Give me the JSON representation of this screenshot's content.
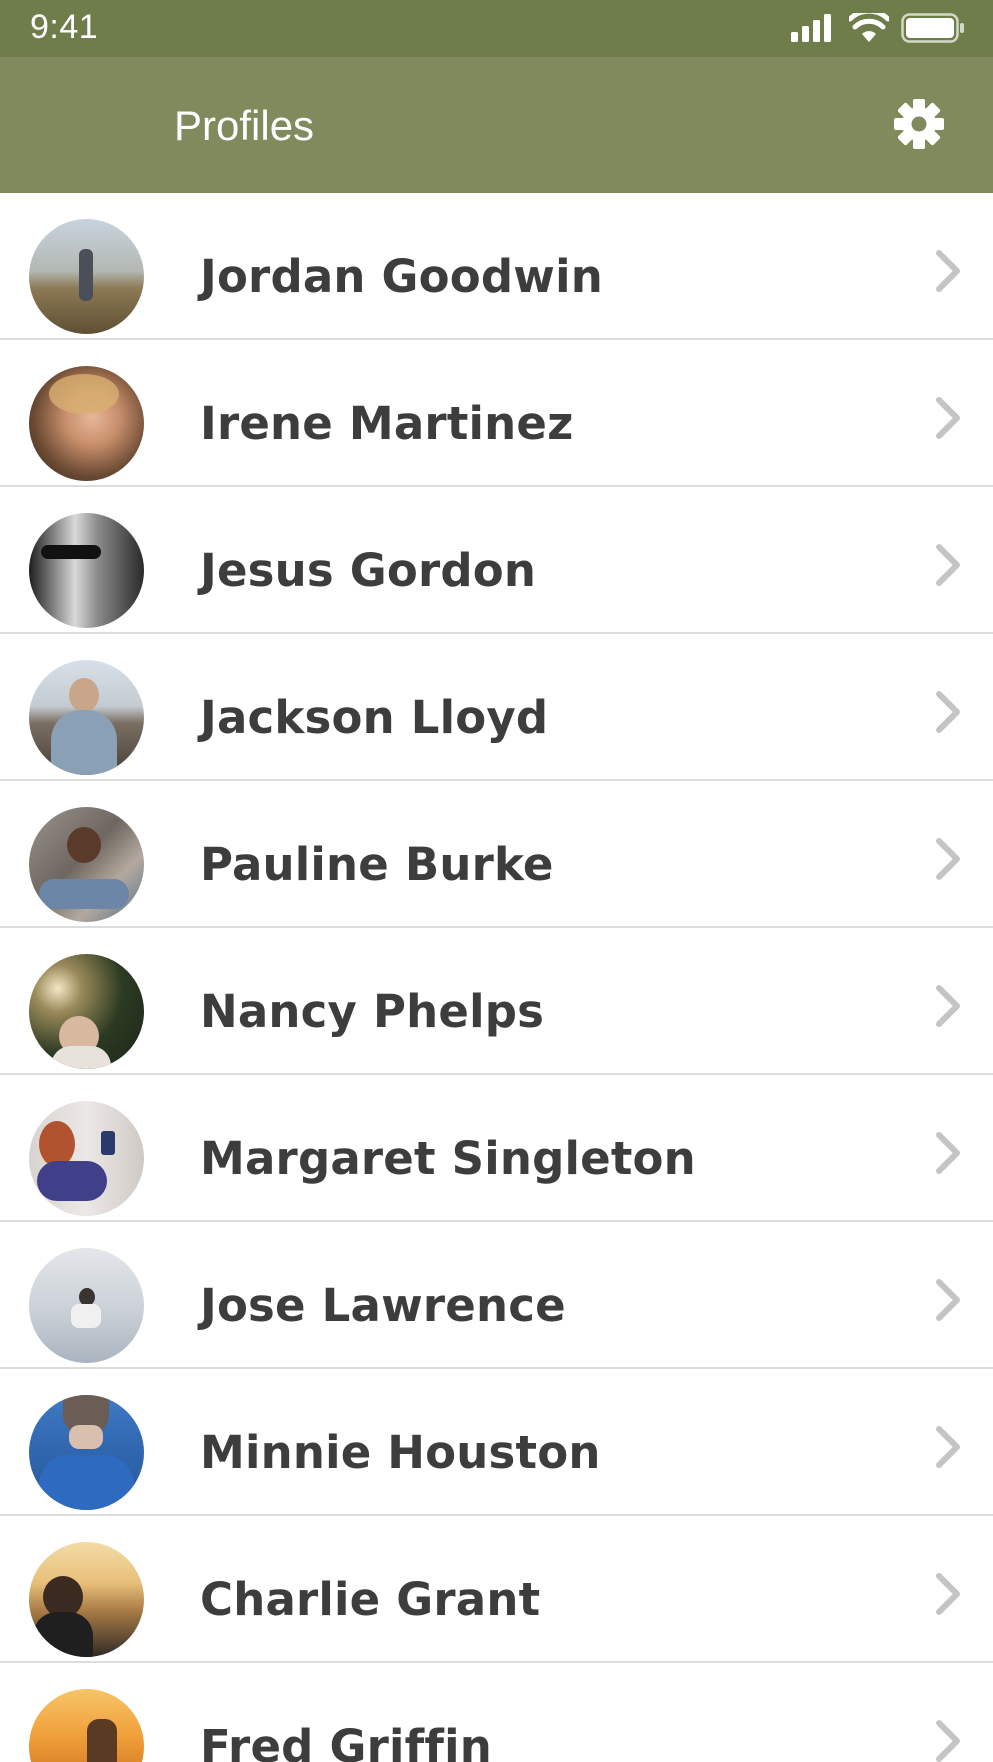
{
  "status_bar": {
    "time": "9:41",
    "icons": [
      "signal-icon",
      "wifi-icon",
      "battery-icon"
    ]
  },
  "header": {
    "title": "Profiles",
    "settings_icon": "gear-icon"
  },
  "colors": {
    "status_bar_bg": "#6f7d4b",
    "nav_bar_bg": "#7f8a5d",
    "name_text": "#3d3d3d",
    "chevron": "#c4c4c4",
    "divider": "#dcdcdc"
  },
  "profiles": [
    {
      "name": "Jordan Goodwin",
      "avatar": "person-in-field-photo"
    },
    {
      "name": "Irene Martinez",
      "avatar": "smiling-woman-photo"
    },
    {
      "name": "Jesus Gordon",
      "avatar": "man-with-sunglasses-photo"
    },
    {
      "name": "Jackson Lloyd",
      "avatar": "man-by-mountains-photo"
    },
    {
      "name": "Pauline Burke",
      "avatar": "woman-sitting-photo"
    },
    {
      "name": "Nancy Phelps",
      "avatar": "woman-under-tree-photo"
    },
    {
      "name": "Margaret Singleton",
      "avatar": "woman-with-phone-photo"
    },
    {
      "name": "Jose Lawrence",
      "avatar": "man-in-water-photo"
    },
    {
      "name": "Minnie Houston",
      "avatar": "person-in-blue-coat-photo"
    },
    {
      "name": "Charlie Grant",
      "avatar": "man-at-sunset-photo"
    },
    {
      "name": "Fred Griffin",
      "avatar": "couple-at-sunset-photo"
    }
  ]
}
